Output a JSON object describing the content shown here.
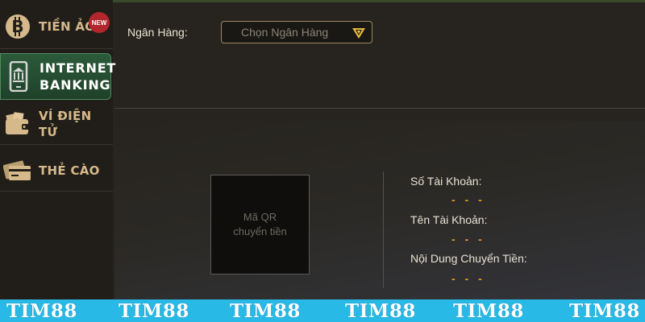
{
  "sidebar": {
    "items": [
      {
        "label": "TIỀN ẢO",
        "icon": "bitcoin-icon",
        "badge": "NEW"
      },
      {
        "label_line1": "INTERNET",
        "label_line2": "BANKING",
        "icon": "bank-phone-icon",
        "active": true
      },
      {
        "label": "VÍ ĐIỆN TỬ",
        "icon": "wallet-icon"
      },
      {
        "label": "THẺ CÀO",
        "icon": "card-icon"
      }
    ]
  },
  "bank": {
    "label": "Ngân Hàng:",
    "placeholder": "Chọn Ngân Hàng"
  },
  "qr": {
    "line1": "Mã QR",
    "line2": "chuyển tiền"
  },
  "fields": [
    {
      "label": "Số Tài Khoản:",
      "value": "- - -"
    },
    {
      "label": "Tên Tài Khoản:",
      "value": "- - -"
    },
    {
      "label": "Nội Dung Chuyển Tiền:",
      "value": "- - -"
    }
  ],
  "watermark": {
    "items": [
      "TIM88",
      "TIM88",
      "TIM88",
      "TIM88",
      "TIM88",
      "TIM88"
    ]
  },
  "colors": {
    "accent": "#e89a2c",
    "active_tab": "#2b5a3a",
    "banner": "#29b9e6",
    "sidebar_text": "#d6b98a",
    "badge": "#b3262b"
  }
}
